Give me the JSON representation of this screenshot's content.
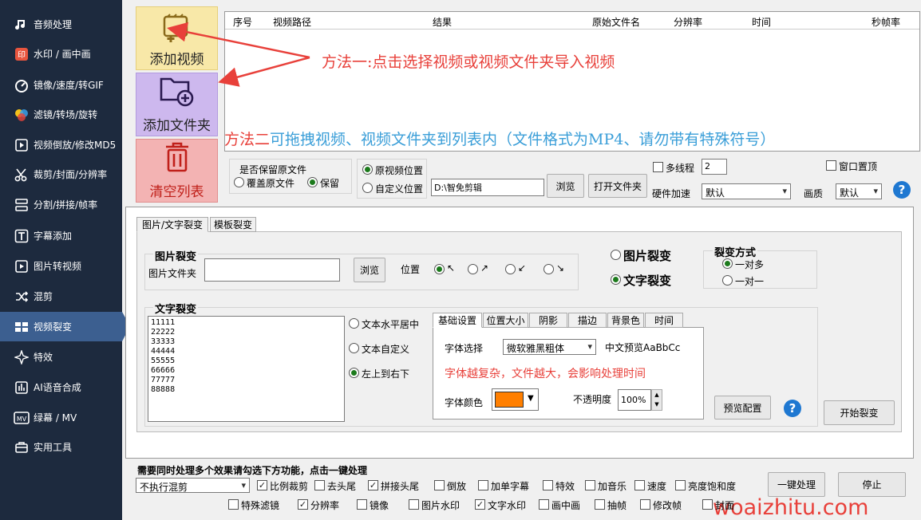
{
  "sidebar": {
    "items": [
      {
        "label": "音频处理",
        "icon": "music-note-icon"
      },
      {
        "label": "水印 / 画中画",
        "icon": "watermark-icon"
      },
      {
        "label": "镜像/速度/转GIF",
        "icon": "speed-icon"
      },
      {
        "label": "滤镜/转场/旋转",
        "icon": "filter-icon"
      },
      {
        "label": "视频倒放/修改MD5",
        "icon": "reverse-play-icon"
      },
      {
        "label": "裁剪/封面/分辨率",
        "icon": "scissors-icon"
      },
      {
        "label": "分割/拼接/帧率",
        "icon": "split-icon"
      },
      {
        "label": "字幕添加",
        "icon": "subtitle-icon"
      },
      {
        "label": "图片转视频",
        "icon": "image-to-video-icon"
      },
      {
        "label": "混剪",
        "icon": "shuffle-icon"
      },
      {
        "label": "视频裂变",
        "icon": "fission-icon"
      },
      {
        "label": "特效",
        "icon": "effects-icon"
      },
      {
        "label": "AI语音合成",
        "icon": "ai-voice-icon"
      },
      {
        "label": "绿幕 / MV",
        "icon": "mv-icon"
      },
      {
        "label": "实用工具",
        "icon": "tools-icon"
      }
    ],
    "active_index": 10
  },
  "buttons": {
    "add_video": "添加视频",
    "add_folder": "添加文件夹",
    "clear_list": "清空列表"
  },
  "list": {
    "columns": [
      "序号",
      "视频路径",
      "结果",
      "原始文件名",
      "分辨率",
      "时间",
      "秒帧率"
    ]
  },
  "annotations": {
    "method1": "方法一:点击选择视频或视频文件夹导入视频",
    "method2_prefix": "方法二",
    "method2_rest": "可拖拽视频、视频文件夹到列表内（文件格式为MP4、请勿带有特殊符号）"
  },
  "settings": {
    "keep_original_label": "是否保留原文件",
    "overwrite": "覆盖原文件",
    "keep": "保留",
    "original_position": "原视频位置",
    "custom_position": "自定义位置",
    "path_value": "D:\\智免剪辑",
    "browse": "浏览",
    "open_folder": "打开文件夹",
    "multithread": "多线程",
    "thread_count": "2",
    "hw_accel": "硬件加速",
    "hw_accel_value": "默认",
    "window_top": "窗口置顶",
    "quality": "画质",
    "quality_value": "默认"
  },
  "panel": {
    "tabs": [
      "图片/文字裂变",
      "模板裂变"
    ],
    "image_fission": {
      "title": "图片裂变",
      "folder_label": "图片文件夹",
      "folder_value": "",
      "browse": "浏览",
      "position_label": "位置",
      "positions": [
        "↖",
        "↗",
        "↙",
        "↘"
      ]
    },
    "mode": {
      "image": "图片裂变",
      "text": "文字裂变"
    },
    "fission_method": {
      "title": "裂变方式",
      "one_to_many": "一对多",
      "one_to_one": "一对一"
    },
    "text_fission": {
      "title": "文字裂变",
      "lines": [
        "11111",
        "22222",
        "33333",
        "44444",
        "55555",
        "66666",
        "77777",
        "88888"
      ],
      "options": [
        "文本水平居中",
        "文本自定义",
        "左上到右下"
      ]
    },
    "sub_tabs": [
      "基础设置",
      "位置大小",
      "阴影",
      "描边",
      "背景色",
      "时间"
    ],
    "font": {
      "label": "字体选择",
      "value": "微软雅黑粗体",
      "preview": "中文预览AaBbCc",
      "warning": "字体越复杂，文件越大，会影响处理时间",
      "color_label": "字体颜色",
      "color": "#ff7f00",
      "opacity_label": "不透明度",
      "opacity_value": "100%"
    },
    "preview_btn": "预览配置",
    "start_btn": "开始裂变"
  },
  "bottom": {
    "title": "需要同时处理多个效果请勾选下方功能，点击一键处理",
    "mix_value": "不执行混剪",
    "row1": [
      {
        "label": "比例裁剪",
        "checked": true
      },
      {
        "label": "去头尾",
        "checked": false
      },
      {
        "label": "拼接头尾",
        "checked": true
      },
      {
        "label": "倒放",
        "checked": false
      },
      {
        "label": "加单字幕",
        "checked": false
      },
      {
        "label": "特效",
        "checked": false
      },
      {
        "label": "加音乐",
        "checked": false
      },
      {
        "label": "速度",
        "checked": false
      },
      {
        "label": "亮度饱和度",
        "checked": false
      }
    ],
    "row2": [
      {
        "label": "特殊滤镜",
        "checked": false
      },
      {
        "label": "分辨率",
        "checked": true
      },
      {
        "label": "镜像",
        "checked": false
      },
      {
        "label": "图片水印",
        "checked": false
      },
      {
        "label": "文字水印",
        "checked": true
      },
      {
        "label": "画中画",
        "checked": false
      },
      {
        "label": "抽帧",
        "checked": false
      },
      {
        "label": "修改帧",
        "checked": false
      },
      {
        "label": "封面",
        "checked": false
      }
    ],
    "one_click": "一键处理",
    "stop": "停止"
  },
  "watermark": "woaizhitu.com",
  "colors": {
    "sidebar_bg": "#1d2a3e",
    "sidebar_active": "#3c5f90",
    "add_video_bg": "#f8e8a8",
    "add_folder_bg": "#cdb8ee",
    "clear_bg": "#f3b3b3",
    "annot_red": "#e8403a",
    "annot_blue": "#3a9ed8"
  }
}
